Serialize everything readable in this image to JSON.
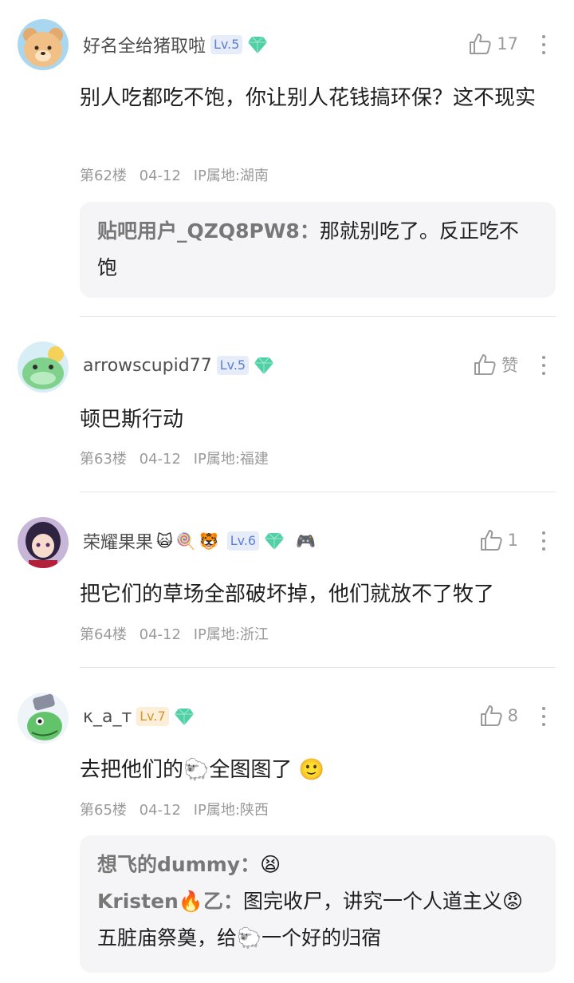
{
  "posts": [
    {
      "username": "好名全给猪取啦",
      "level": "Lv.5",
      "likes": "17",
      "content": "别人吃都吃不饱，你让别人花钱搞环保？这不现实",
      "floor": "第62楼",
      "date": "04-12",
      "ip": "IP属地:湖南",
      "replies": [
        {
          "name": "贴吧用户_QZQ8PW8：",
          "text": "那就别吃了。反正吃不饱"
        }
      ]
    },
    {
      "username": "arrowscupid77",
      "level": "Lv.5",
      "likes": "赞",
      "content": "顿巴斯行动",
      "floor": "第63楼",
      "date": "04-12",
      "ip": "IP属地:福建"
    },
    {
      "username": "荣耀果果",
      "name_emojis": [
        "🙀",
        "🍭",
        "🐯"
      ],
      "level": "Lv.6",
      "extra_icon": "🎮",
      "likes": "1",
      "content": "把它们的草场全部破坏掉，他们就放不了牧了",
      "floor": "第64楼",
      "date": "04-12",
      "ip": "IP属地:浙江"
    },
    {
      "username": "κ_a_т",
      "level": "Lv.7",
      "likes": "8",
      "content": "去把他们的🐑全图图了 🙂",
      "floor": "第65楼",
      "date": "04-12",
      "ip": "IP属地:陕西",
      "replies": [
        {
          "name": "想飞的dummy：",
          "text": "😫"
        },
        {
          "name": "Kristen🔥乙：",
          "text": "图完收尸，讲究一个人道主义😡 五脏庙祭奠，给🐑一个好的归宿"
        }
      ]
    }
  ],
  "colors": {
    "text": "#1e1e1e",
    "secondary": "#9a9a9a",
    "reply_bg": "#f5f5f7",
    "gem": "#4fd1a5"
  }
}
